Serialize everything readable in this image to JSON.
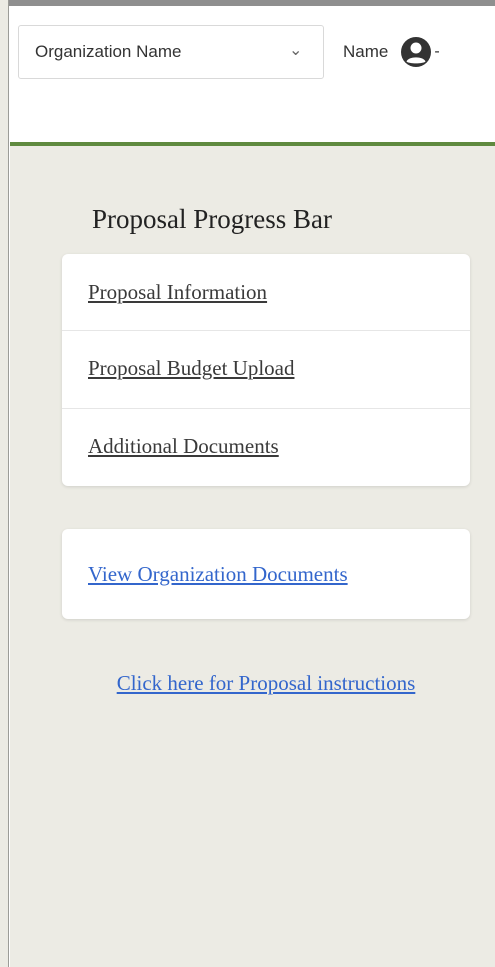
{
  "header": {
    "organization_select": {
      "value": "Organization Name"
    },
    "user_menu": {
      "label": "Name",
      "icon": "user-circle-icon"
    }
  },
  "sidebar": {
    "progress_title": "Proposal Progress Bar",
    "progress_items": [
      {
        "label": "Proposal Information"
      },
      {
        "label": "Proposal Budget Upload"
      },
      {
        "label": "Additional Documents"
      }
    ],
    "org_documents_link": "View Organization Documents",
    "instructions_link": "Click here for Proposal instructions"
  },
  "colors": {
    "sidebar_bg": "#ecebe4",
    "header_rule": "#5f8a3f",
    "link_blue": "#3366cc",
    "text_dark": "#3a3a3a"
  }
}
